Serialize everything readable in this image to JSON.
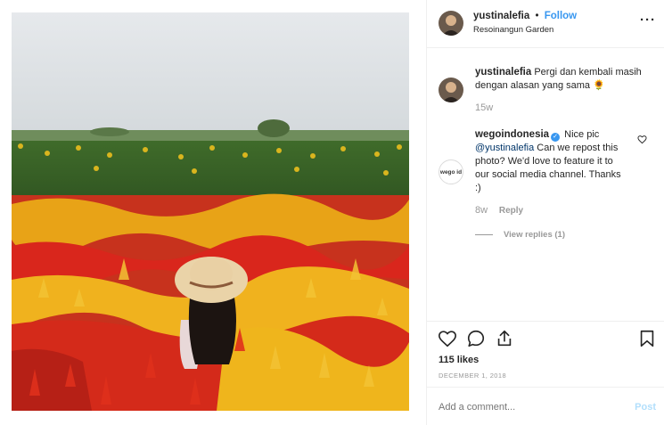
{
  "header": {
    "username": "yustinalefia",
    "separator": "•",
    "follow_label": "Follow",
    "location": "Resoinangun Garden",
    "more_label": "···"
  },
  "comments": [
    {
      "username": "yustinalefia",
      "text": "Pergi dan kembali masih dengan alasan yang sama",
      "emoji": "🌻",
      "time": "15w"
    },
    {
      "username": "wegoindonesia",
      "verified_mark": "✓",
      "text_before": "Nice pic",
      "mention": "@yustinalefia",
      "text_after": "Can we repost this photo? We'd love to feature it to our social media channel. Thanks :)",
      "avatar_text": "wego id",
      "time": "8w",
      "reply_label": "Reply",
      "view_replies_label": "View replies (1)"
    }
  ],
  "actions": {
    "icons": [
      "heart-icon",
      "comment-icon",
      "share-icon",
      "bookmark-icon"
    ]
  },
  "likes": "115 likes",
  "date": "DECEMBER 1, 2018",
  "add_comment": {
    "placeholder": "Add a comment...",
    "post_label": "Post"
  },
  "colors": {
    "accent": "#3897f0",
    "muted": "#999999",
    "post_disabled": "#b2dffc"
  }
}
